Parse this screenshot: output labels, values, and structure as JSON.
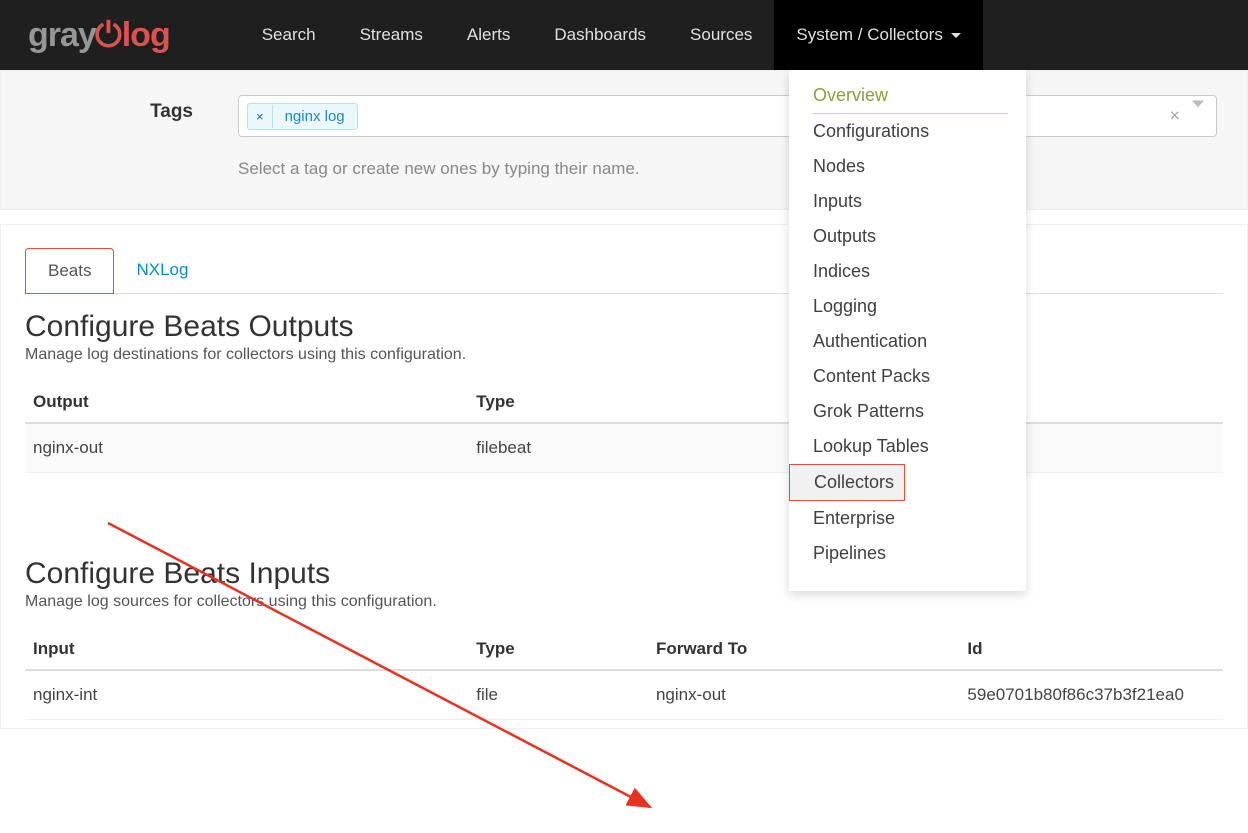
{
  "nav": {
    "logo_gray": "gray",
    "logo_rest": "log",
    "items": [
      "Search",
      "Streams",
      "Alerts",
      "Dashboards",
      "Sources",
      "System / Collectors"
    ]
  },
  "dropdown": {
    "items": [
      "Overview",
      "Configurations",
      "Nodes",
      "Inputs",
      "Outputs",
      "Indices",
      "Logging",
      "Authentication",
      "Content Packs",
      "Grok Patterns",
      "Lookup Tables",
      "Collectors",
      "Enterprise",
      "Pipelines"
    ]
  },
  "tags": {
    "label": "Tags",
    "chip": "nginx log",
    "help": "Select a tag or create new ones by typing their name."
  },
  "tabs": {
    "beats": "Beats",
    "nxlog": "NXLog"
  },
  "outputs": {
    "title": "Configure Beats Outputs",
    "desc": "Manage log destinations for collectors using this configuration.",
    "headers": [
      "Output",
      "Type"
    ],
    "rows": [
      {
        "output": "nginx-out",
        "type": "filebeat"
      }
    ]
  },
  "inputs": {
    "title": "Configure Beats Inputs",
    "desc": "Manage log sources for collectors using this configuration.",
    "headers": [
      "Input",
      "Type",
      "Forward To",
      "Id"
    ],
    "rows": [
      {
        "input": "nginx-int",
        "type": "file",
        "forward_to": "nginx-out",
        "id": "59e0701b80f86c37b3f21ea0"
      }
    ]
  }
}
